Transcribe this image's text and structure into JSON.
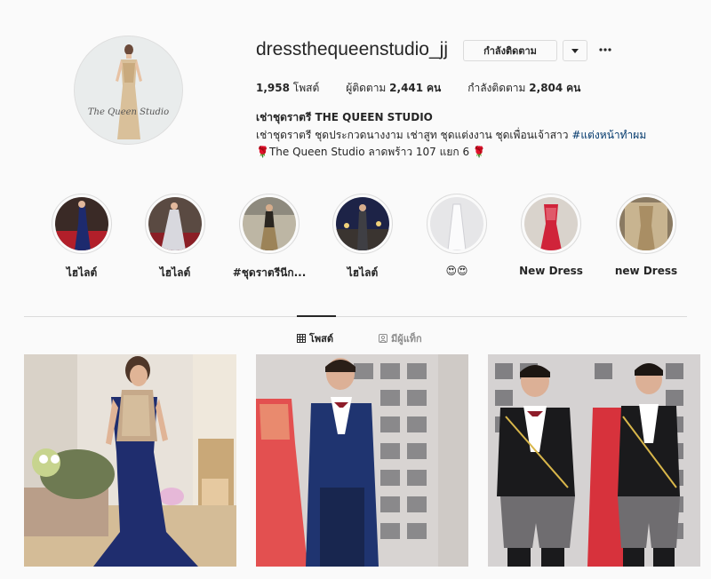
{
  "profile": {
    "username": "dressthequeenstudio_jj",
    "following_button_label": "กำลังติดตาม",
    "avatar_caption": "The Queen Studio",
    "stats": {
      "posts_value": "1,958",
      "posts_label": "โพสต์",
      "followers_label": "ผู้ติดตาม",
      "followers_value": "2,441",
      "followers_unit": "คน",
      "following_label": "กำลังติดตาม",
      "following_value": "2,804",
      "following_unit": "คน"
    },
    "bio": {
      "name": "เช่าชุดราตรี THE QUEEN STUDIO",
      "line1_text": "เช่าชุดราตรี ชุดประกวดนางงาม เช่าสูท ชุดแต่งงาน ชุดเพื่อนเจ้าสาว ",
      "line1_hashtag": "#แต่งหน้าทำผม",
      "line2_rose_left": "🌹",
      "line2_text": "The Queen Studio ลาดพร้าว 107 แยก 6 ",
      "line2_rose_right": "🌹"
    }
  },
  "highlights": [
    {
      "label": "ไฮไลต์"
    },
    {
      "label": "ไฮไลต์"
    },
    {
      "label": "#ชุดราตรีนีก..."
    },
    {
      "label": "ไฮไลต์"
    },
    {
      "label": "😍😍"
    },
    {
      "label": "New Dress"
    },
    {
      "label": "new Dress"
    }
  ],
  "tabs": {
    "posts_label": "โพสต์",
    "tagged_label": "มีผู้แท็ก"
  },
  "icons": {
    "grid": "grid-icon",
    "tagged": "tag-person-icon",
    "chevron": "chevron-down-icon",
    "more": "more-horizontal-icon"
  },
  "colors": {
    "background": "#fafafa",
    "text": "#262626",
    "muted": "#8e8e8e",
    "border": "#dbdbdb",
    "hashtag": "#00376b"
  }
}
